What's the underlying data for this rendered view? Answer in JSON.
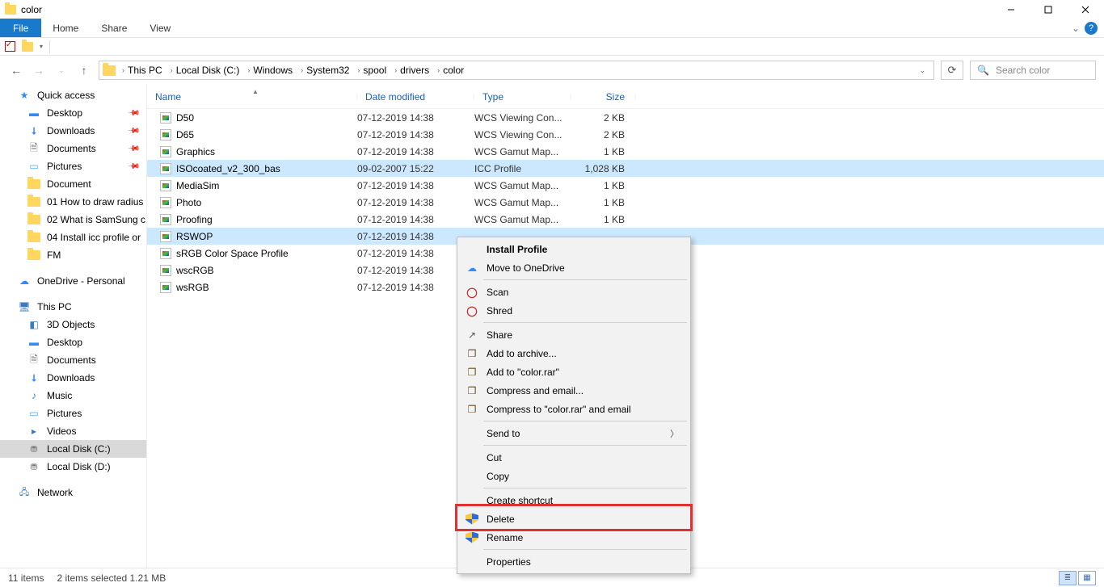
{
  "window": {
    "title": "color"
  },
  "ribbon": {
    "tabs": {
      "file": "File",
      "home": "Home",
      "share": "Share",
      "view": "View"
    }
  },
  "address": {
    "segments": [
      "This PC",
      "Local Disk (C:)",
      "Windows",
      "System32",
      "spool",
      "drivers",
      "color"
    ]
  },
  "search": {
    "placeholder": "Search color"
  },
  "nav": {
    "quick_access": "Quick access",
    "qa_items": [
      {
        "label": "Desktop",
        "icon": "ico-desk",
        "pinned": true
      },
      {
        "label": "Downloads",
        "icon": "ico-down",
        "pinned": true
      },
      {
        "label": "Documents",
        "icon": "ico-doc",
        "pinned": true
      },
      {
        "label": "Pictures",
        "icon": "ico-pic",
        "pinned": true
      },
      {
        "label": "Document",
        "icon": "ico-fld",
        "pinned": false
      },
      {
        "label": "01 How to draw radius",
        "icon": "ico-fld",
        "pinned": false
      },
      {
        "label": "02 What is SamSung c",
        "icon": "ico-fld",
        "pinned": false
      },
      {
        "label": "04 Install icc profile or",
        "icon": "ico-fld",
        "pinned": false
      },
      {
        "label": "FM",
        "icon": "ico-fld",
        "pinned": false
      }
    ],
    "onedrive": "OneDrive - Personal",
    "this_pc": "This PC",
    "pc_items": [
      {
        "label": "3D Objects",
        "icon": "ico-3d"
      },
      {
        "label": "Desktop",
        "icon": "ico-desk"
      },
      {
        "label": "Documents",
        "icon": "ico-doc"
      },
      {
        "label": "Downloads",
        "icon": "ico-down"
      },
      {
        "label": "Music",
        "icon": "ico-music"
      },
      {
        "label": "Pictures",
        "icon": "ico-pic"
      },
      {
        "label": "Videos",
        "icon": "ico-vid"
      },
      {
        "label": "Local Disk (C:)",
        "icon": "ico-disk",
        "selected": true
      },
      {
        "label": "Local Disk (D:)",
        "icon": "ico-disk"
      }
    ],
    "network": "Network"
  },
  "columns": {
    "name": "Name",
    "date": "Date modified",
    "type": "Type",
    "size": "Size"
  },
  "files": [
    {
      "name": "D50",
      "date": "07-12-2019 14:38",
      "type": "WCS Viewing Con...",
      "size": "2 KB",
      "selected": false
    },
    {
      "name": "D65",
      "date": "07-12-2019 14:38",
      "type": "WCS Viewing Con...",
      "size": "2 KB",
      "selected": false
    },
    {
      "name": "Graphics",
      "date": "07-12-2019 14:38",
      "type": "WCS Gamut Map...",
      "size": "1 KB",
      "selected": false
    },
    {
      "name": "ISOcoated_v2_300_bas",
      "date": "09-02-2007 15:22",
      "type": "ICC Profile",
      "size": "1,028 KB",
      "selected": true
    },
    {
      "name": "MediaSim",
      "date": "07-12-2019 14:38",
      "type": "WCS Gamut Map...",
      "size": "1 KB",
      "selected": false
    },
    {
      "name": "Photo",
      "date": "07-12-2019 14:38",
      "type": "WCS Gamut Map...",
      "size": "1 KB",
      "selected": false
    },
    {
      "name": "Proofing",
      "date": "07-12-2019 14:38",
      "type": "WCS Gamut Map...",
      "size": "1 KB",
      "selected": false
    },
    {
      "name": "RSWOP",
      "date": "07-12-2019 14:38",
      "type": "",
      "size": "",
      "selected": true
    },
    {
      "name": "sRGB Color Space Profile",
      "date": "07-12-2019 14:38",
      "type": "",
      "size": "",
      "selected": false
    },
    {
      "name": "wscRGB",
      "date": "07-12-2019 14:38",
      "type": "",
      "size": "",
      "selected": false
    },
    {
      "name": "wsRGB",
      "date": "07-12-2019 14:38",
      "type": "",
      "size": "",
      "selected": false
    }
  ],
  "context_menu": {
    "items": [
      {
        "label": "Install Profile",
        "bold": true
      },
      {
        "label": "Move to OneDrive",
        "icon": "cloud"
      },
      {
        "sep": true
      },
      {
        "label": "Scan",
        "icon": "mcaf"
      },
      {
        "label": "Shred",
        "icon": "mcaf"
      },
      {
        "sep": true
      },
      {
        "label": "Share",
        "icon": "share"
      },
      {
        "label": "Add to archive...",
        "icon": "rar"
      },
      {
        "label": "Add to \"color.rar\"",
        "icon": "rar"
      },
      {
        "label": "Compress and email...",
        "icon": "rar"
      },
      {
        "label": "Compress to \"color.rar\" and email",
        "icon": "rar"
      },
      {
        "sep": true
      },
      {
        "label": "Send to",
        "arrow": true
      },
      {
        "sep": true
      },
      {
        "label": "Cut"
      },
      {
        "label": "Copy"
      },
      {
        "sep": true
      },
      {
        "label": "Create shortcut"
      },
      {
        "label": "Delete",
        "icon": "shield",
        "highlight": true
      },
      {
        "label": "Rename",
        "icon": "shield"
      },
      {
        "sep": true
      },
      {
        "label": "Properties"
      }
    ]
  },
  "status": {
    "count": "11 items",
    "selection": "2 items selected  1.21 MB"
  }
}
